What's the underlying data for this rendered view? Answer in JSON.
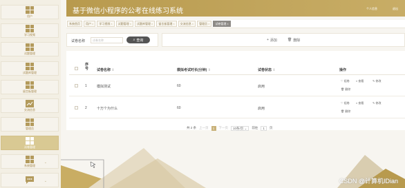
{
  "sidebar": {
    "items": [
      {
        "label": "用户",
        "active": false,
        "icon": "grid-icon",
        "chevron": false
      },
      {
        "label": "学习视频",
        "active": false,
        "icon": "grid-icon",
        "chevron": false
      },
      {
        "label": "试题管理",
        "active": false,
        "icon": "grid-icon",
        "chevron": false
      },
      {
        "label": "试题库管理",
        "active": false,
        "icon": "grid-icon",
        "chevron": false
      },
      {
        "label": "留言板管理",
        "active": false,
        "icon": "grid-icon",
        "chevron": false
      },
      {
        "label": "交流信息",
        "active": false,
        "icon": "trend-icon",
        "chevron": false
      },
      {
        "label": "管理员",
        "active": false,
        "icon": "grid-icon",
        "chevron": false
      },
      {
        "label": "试卷管理",
        "active": true,
        "icon": "grid-icon",
        "chevron": false
      },
      {
        "label": "系统管理",
        "active": false,
        "icon": "grid-icon",
        "chevron": true
      },
      {
        "label": "",
        "active": false,
        "icon": "chat-icon",
        "chevron": true
      }
    ]
  },
  "header": {
    "title": "基于微信小程序的公考在线练习系统",
    "user": "个人信息",
    "exit": "退出"
  },
  "tabs": [
    {
      "label": "系统首页",
      "closable": false,
      "active": false
    },
    {
      "label": "用户",
      "closable": true,
      "active": false
    },
    {
      "label": "学习视频",
      "closable": true,
      "active": false
    },
    {
      "label": "试题管理",
      "closable": true,
      "active": false
    },
    {
      "label": "试题库管理",
      "closable": true,
      "active": false
    },
    {
      "label": "留言板管理",
      "closable": true,
      "active": false
    },
    {
      "label": "交流信息",
      "closable": true,
      "active": false
    },
    {
      "label": "管理员",
      "closable": true,
      "active": false
    },
    {
      "label": "试卷管理",
      "closable": true,
      "active": true
    }
  ],
  "search": {
    "label": "试卷名称",
    "placeholder": "试卷名称",
    "button": "查询"
  },
  "actions": {
    "add": "添加",
    "delete": "删除"
  },
  "table": {
    "headers": {
      "index": "序号",
      "name": "试卷名称",
      "duration": "模拟考试时长(分钟)",
      "status": "试卷状态",
      "ops": "操作"
    },
    "rows": [
      {
        "index": "1",
        "name": "模拟测试",
        "duration": "60",
        "status": "启用"
      },
      {
        "index": "2",
        "name": "十万个为什么",
        "duration": "60",
        "status": "启用"
      }
    ],
    "op_labels": {
      "edit": "组卷",
      "view": "查看",
      "modify": "修改",
      "delete": "删除"
    }
  },
  "pager": {
    "total": "共 2 条",
    "prev": "上一页",
    "page": "1",
    "next": "下一页",
    "per_page": "10条/页",
    "goto": "前往",
    "goto_page": "1",
    "page_unit": "页"
  },
  "watermark": "CSDN @计算机IDian",
  "colors": {
    "accent": "#c8ad66",
    "active_sidebar": "#d9c993"
  }
}
